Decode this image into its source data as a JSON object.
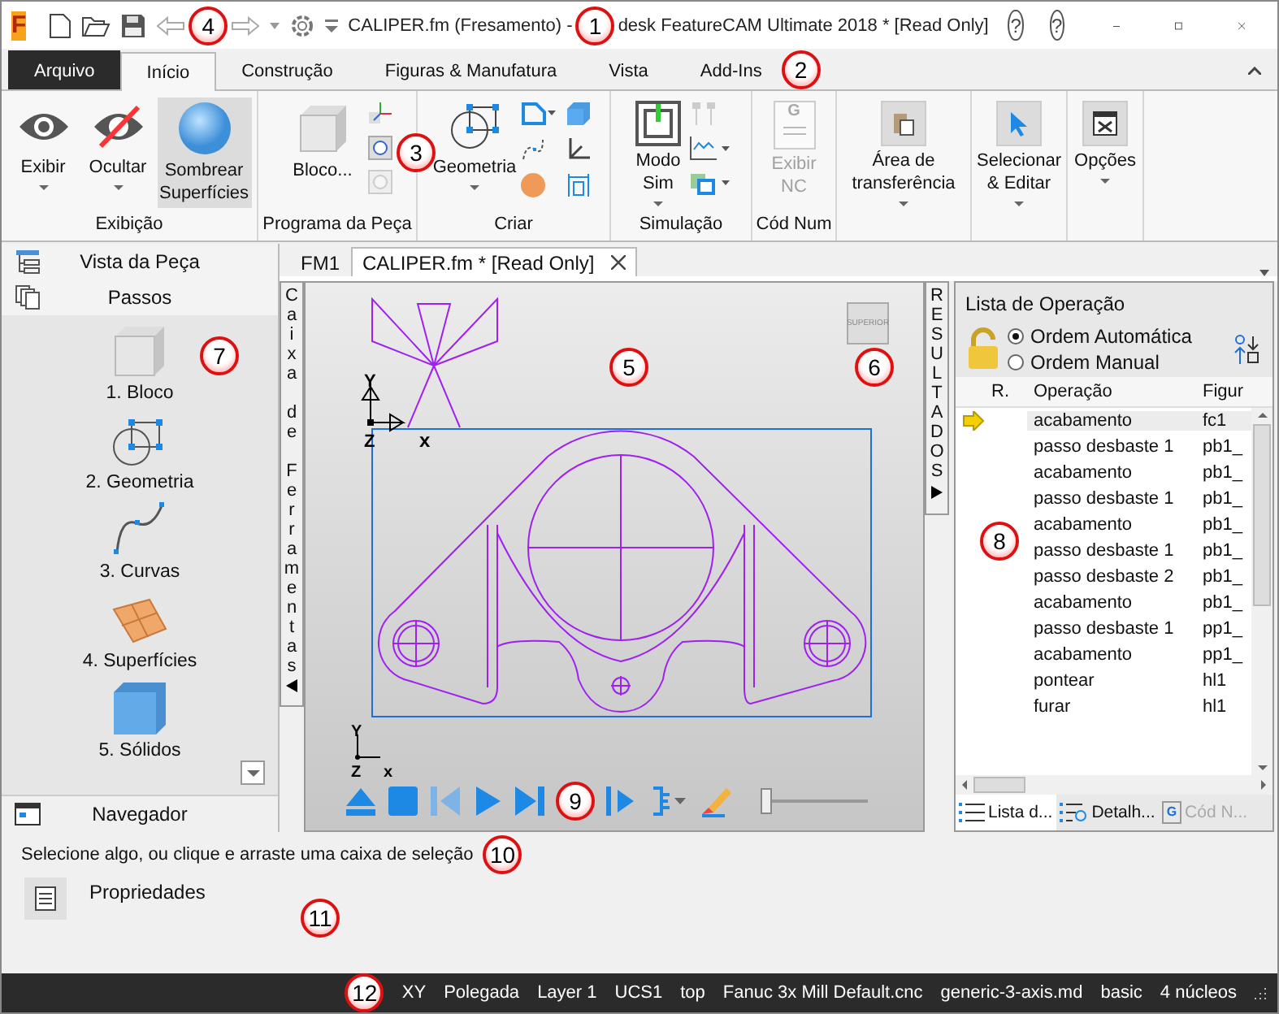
{
  "window": {
    "app_logo": "F",
    "title_left": "CALIPER.fm (Fresamento) -",
    "title_right": "desk FeatureCAM Ultimate 2018 * [Read Only]",
    "help_buttons": [
      "?",
      "?"
    ]
  },
  "ribbon_tabs": [
    {
      "label": "Arquivo",
      "kind": "file",
      "selected": false
    },
    {
      "label": "Início",
      "kind": "tab",
      "selected": true
    },
    {
      "label": "Construção",
      "kind": "tab",
      "selected": false
    },
    {
      "label": "Figuras & Manufatura",
      "kind": "tab",
      "selected": false
    },
    {
      "label": "Vista",
      "kind": "tab",
      "selected": false
    },
    {
      "label": "Add-Ins",
      "kind": "tab",
      "selected": false
    }
  ],
  "ribbon_groups": [
    {
      "label": "Exibição",
      "buttons": [
        {
          "label": "Exibir",
          "dropdown": true,
          "selected": false
        },
        {
          "label": "Ocultar",
          "dropdown": true,
          "selected": false
        },
        {
          "label": "Sombrear Superfícies",
          "dropdown": false,
          "selected": true
        }
      ]
    },
    {
      "label": "Programa da Peça",
      "buttons": [
        {
          "label": "Bloco...",
          "dropdown": false,
          "selected": false
        }
      ]
    },
    {
      "label": "Criar",
      "buttons": [
        {
          "label": "Geometria",
          "dropdown": true,
          "selected": false
        }
      ]
    },
    {
      "label": "Simulação",
      "buttons": [
        {
          "label": "Modo Sim",
          "dropdown": true,
          "selected": false
        }
      ]
    },
    {
      "label": "Cód Num",
      "buttons": [
        {
          "label": "Exibir NC",
          "dropdown": false,
          "selected": false,
          "disabled": true,
          "icon_letter": "G"
        }
      ]
    },
    {
      "buttons": [
        {
          "label": "Área de transferência",
          "dropdown": true,
          "selected": false
        }
      ]
    },
    {
      "buttons": [
        {
          "label": "Selecionar & Editar",
          "dropdown": true,
          "selected": false
        }
      ]
    },
    {
      "buttons": [
        {
          "label": "Opções",
          "dropdown": true,
          "selected": false
        }
      ]
    }
  ],
  "left_panel": {
    "tabs": [
      {
        "label": "Vista da Peça"
      },
      {
        "label": "Passos"
      }
    ],
    "steps": [
      {
        "label": "1.  Bloco"
      },
      {
        "label": "2.  Geometria"
      },
      {
        "label": "3.  Curvas"
      },
      {
        "label": "4.  Superfícies"
      },
      {
        "label": "5.  Sólidos"
      }
    ],
    "navigator": "Navegador"
  },
  "document_tabs": [
    {
      "label": "FM1",
      "selected": false,
      "closable": false
    },
    {
      "label": "CALIPER.fm * [Read Only]",
      "selected": true,
      "closable": true
    }
  ],
  "toolbox_label": "Caixa de Ferramentas",
  "results_label": "RESULTADOS",
  "viewport": {
    "view_cube": "SUPERIOR",
    "triad_top": [
      "Y",
      "Z",
      "x"
    ],
    "triad_bottom": [
      "Y",
      "Z",
      "x"
    ],
    "slider": {
      "level": 0.05
    }
  },
  "operations": {
    "title": "Lista de Operação",
    "order_options": [
      {
        "label": "Ordem Automática",
        "selected": true
      },
      {
        "label": "Ordem Manual",
        "selected": false
      }
    ],
    "columns": [
      "R.",
      "Operação",
      "Figur"
    ],
    "rows": [
      {
        "operation": "acabamento",
        "feature": "fc1",
        "current": true,
        "selected": true
      },
      {
        "operation": "passo desbaste 1",
        "feature": "pb1_",
        "current": false,
        "selected": false
      },
      {
        "operation": "acabamento",
        "feature": "pb1_",
        "current": false,
        "selected": false
      },
      {
        "operation": "passo desbaste 1",
        "feature": "pb1_",
        "current": false,
        "selected": false
      },
      {
        "operation": "acabamento",
        "feature": "pb1_",
        "current": false,
        "selected": false
      },
      {
        "operation": "passo desbaste 1",
        "feature": "pb1_",
        "current": false,
        "selected": false
      },
      {
        "operation": "passo desbaste 2",
        "feature": "pb1_",
        "current": false,
        "selected": false
      },
      {
        "operation": "acabamento",
        "feature": "pb1_",
        "current": false,
        "selected": false
      },
      {
        "operation": "passo desbaste 1",
        "feature": "pp1_",
        "current": false,
        "selected": false
      },
      {
        "operation": "acabamento",
        "feature": "pp1_",
        "current": false,
        "selected": false
      },
      {
        "operation": "pontear",
        "feature": "hl1",
        "current": false,
        "selected": false
      },
      {
        "operation": "furar",
        "feature": "hl1",
        "current": false,
        "selected": false
      }
    ],
    "tabs": [
      {
        "label": "Lista d...",
        "selected": true,
        "disabled": false
      },
      {
        "label": "Detalh...",
        "selected": false,
        "disabled": false
      },
      {
        "label": "Cód N...",
        "selected": false,
        "disabled": true,
        "icon_letter": "G"
      }
    ]
  },
  "message": "Selecione algo, ou clique e arraste uma caixa de seleção",
  "properties": "Propriedades",
  "status_bar": [
    "XY",
    "Polegada",
    "Layer 1",
    "UCS1",
    "top",
    "Fanuc 3x Mill Default.cnc",
    "generic-3-axis.md",
    "basic",
    "4 núcleos"
  ],
  "callouts": [
    {
      "number": "1"
    },
    {
      "number": "2"
    },
    {
      "number": "3"
    },
    {
      "number": "4"
    },
    {
      "number": "5"
    },
    {
      "number": "6"
    },
    {
      "number": "7"
    },
    {
      "number": "8"
    },
    {
      "number": "9"
    },
    {
      "number": "10"
    },
    {
      "number": "11"
    },
    {
      "number": "12"
    }
  ]
}
